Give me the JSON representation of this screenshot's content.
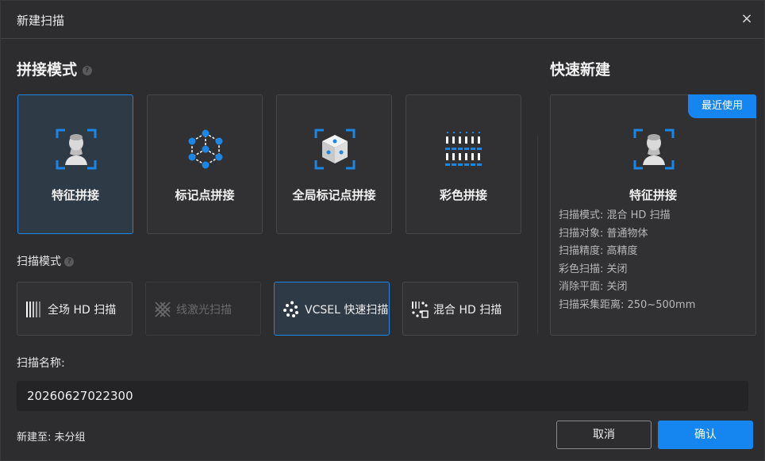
{
  "dialog": {
    "title": "新建扫描",
    "close_glyph": "×"
  },
  "stitch": {
    "title": "拼接模式",
    "help_glyph": "?",
    "cards": [
      {
        "label": "特征拼接",
        "icon": "bust-icon",
        "selected": true
      },
      {
        "label": "标记点拼接",
        "icon": "marker-points-icon",
        "selected": false
      },
      {
        "label": "全局标记点拼接",
        "icon": "global-marker-cube-icon",
        "selected": false
      },
      {
        "label": "彩色拼接",
        "icon": "color-grid-icon",
        "selected": false
      }
    ]
  },
  "scan_mode": {
    "title": "扫描模式",
    "help_glyph": "?",
    "modes": [
      {
        "label": "全场 HD 扫描",
        "icon": "fullfield-stripes-icon",
        "state": "normal"
      },
      {
        "label": "线激光扫描",
        "icon": "laser-cross-icon",
        "state": "disabled"
      },
      {
        "label": "VCSEL 快速扫描",
        "icon": "vcsel-dots-icon",
        "state": "selected"
      },
      {
        "label": "混合 HD 扫描",
        "icon": "hybrid-icon",
        "state": "normal"
      }
    ]
  },
  "scan_name": {
    "label": "扫描名称:",
    "value": "20260627022300"
  },
  "save_to": "新建至: 未分组",
  "buttons": {
    "cancel": "取消",
    "confirm": "确认"
  },
  "quick": {
    "title": "快速新建",
    "badge": "最近使用",
    "name": "特征拼接",
    "icon": "bust-icon",
    "info": [
      "扫描模式: 混合 HD 扫描",
      "扫描对象: 普通物体",
      "扫描精度: 高精度",
      "彩色扫描: 关闭",
      "消除平面: 关闭",
      "扫描采集距离: 250~500mm"
    ]
  },
  "colors": {
    "accent": "#1586f0",
    "selected_border": "#1a86e6",
    "background": "#2d2d2f"
  }
}
